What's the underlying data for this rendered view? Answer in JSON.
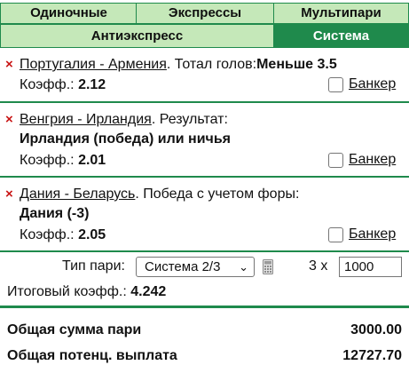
{
  "tabs": {
    "single": "Одиночные",
    "express": "Экспрессы",
    "multi": "Мультипари",
    "anti": "Антиэкспресс",
    "system": "Система"
  },
  "bets": [
    {
      "remove": "×",
      "match": "Португалия - Армения",
      "market": ". Тотал голов:",
      "outcome": "Меньше 3.5",
      "coef_label": "Коэфф.:",
      "coef": "2.12",
      "banker": "Банкер"
    },
    {
      "remove": "×",
      "match": "Венгрия - Ирландия",
      "market": ". Результат:",
      "outcome": "Ирландия (победа) или ничья",
      "coef_label": "Коэфф.:",
      "coef": "2.01",
      "banker": "Банкер"
    },
    {
      "remove": "×",
      "match": "Дания - Беларусь",
      "market": ". Победа с учетом форы:",
      "outcome": "Дания (-3)",
      "coef_label": "Коэфф.:",
      "coef": "2.05",
      "banker": "Банкер"
    }
  ],
  "system": {
    "type_label": "Тип пари:",
    "type_value": "Система 2/3",
    "multiplier": "3 x",
    "stake": "1000"
  },
  "total_coef": {
    "label": "Итоговый коэфф.:",
    "value": "4.242"
  },
  "summary": {
    "total_label": "Общая сумма пари",
    "total_value": "3000.00",
    "payout_label": "Общая потенц. выплата",
    "payout_value": "12727.70"
  },
  "colors": {
    "accent": "#1f8a4c",
    "tab_bg": "#c5e8b9",
    "remove": "#c81414"
  },
  "icons": {
    "remove": "close-icon",
    "calc": "calculator-icon",
    "caret": "chevron-down-icon"
  }
}
